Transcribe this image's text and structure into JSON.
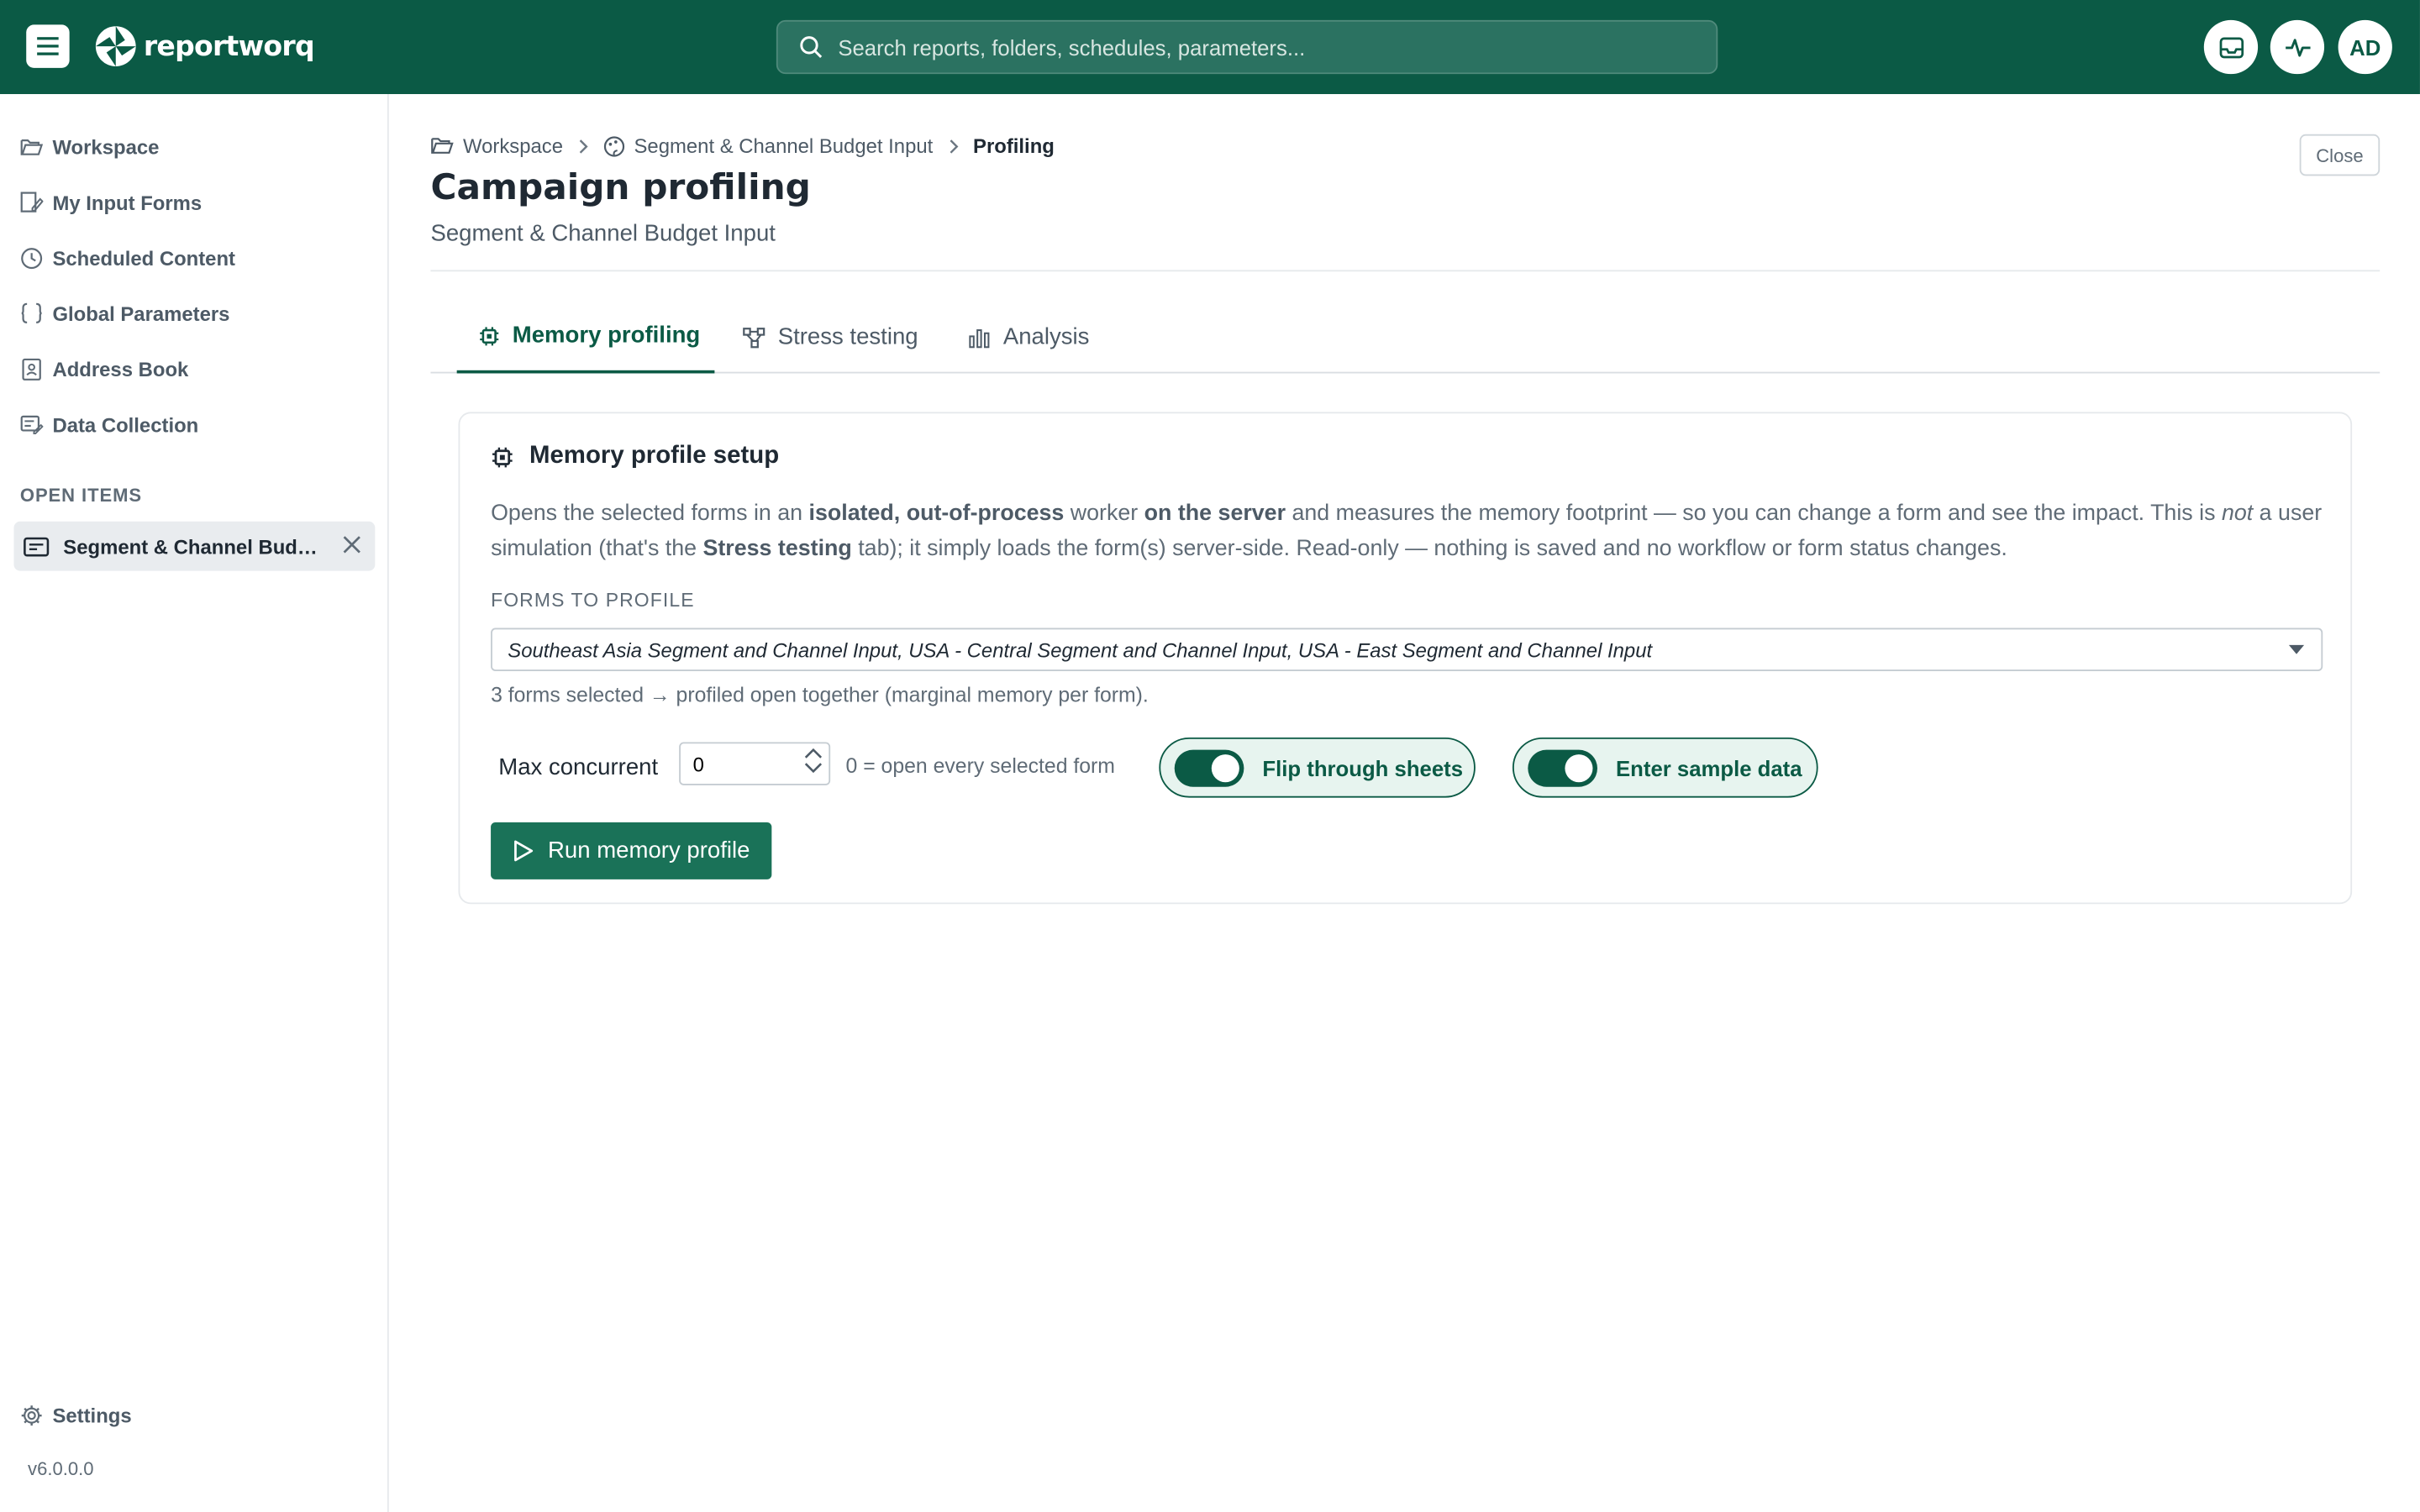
{
  "header": {
    "brand": "reportworq",
    "search_placeholder": "Search reports, folders, schedules, parameters...",
    "avatar_initials": "AD"
  },
  "sidebar": {
    "items": [
      {
        "label": "Workspace",
        "icon": "folder-open-icon"
      },
      {
        "label": "My Input Forms",
        "icon": "form-edit-icon"
      },
      {
        "label": "Scheduled Content",
        "icon": "clock-icon"
      },
      {
        "label": "Global Parameters",
        "icon": "braces-icon"
      },
      {
        "label": "Address Book",
        "icon": "address-book-icon"
      },
      {
        "label": "Data Collection",
        "icon": "data-collection-icon"
      }
    ],
    "open_items_label": "OPEN ITEMS",
    "open_item": "Segment & Channel Budget Input",
    "settings_label": "Settings",
    "version": "v6.0.0.0"
  },
  "breadcrumb": {
    "items": [
      "Workspace",
      "Segment & Channel Budget Input",
      "Profiling"
    ]
  },
  "page": {
    "title": "Campaign profiling",
    "subtitle": "Segment & Channel Budget Input",
    "close_label": "Close"
  },
  "tabs": [
    {
      "label": "Memory profiling",
      "active": true
    },
    {
      "label": "Stress testing",
      "active": false
    },
    {
      "label": "Analysis",
      "active": false
    }
  ],
  "card": {
    "title": "Memory profile setup",
    "description": {
      "p1": "Opens the selected forms in an ",
      "b1": "isolated, out-of-process",
      "p2": " worker ",
      "b2": "on the server",
      "p3": " and measures the memory footprint — so you can change a form and see the impact. This is ",
      "i1": "not",
      "p4": " a user simulation (that's the ",
      "b3": "Stress testing",
      "p5": " tab); it simply loads the form(s) server-side. Read-only — nothing is saved and no workflow or form status changes."
    },
    "forms_label": "FORMS TO PROFILE",
    "forms_selected": "Southeast Asia Segment and Channel Input, USA - Central Segment and Channel Input, USA - East Segment and Channel Input",
    "forms_hint": "3 forms selected → profiled open together (marginal memory per form).",
    "max_concurrent_label": "Max concurrent",
    "max_concurrent_value": "0",
    "max_concurrent_hint": "0 = open every selected form",
    "toggle_flip_label": "Flip through sheets",
    "toggle_flip_on": true,
    "toggle_sample_label": "Enter sample data",
    "toggle_sample_on": true,
    "run_label": "Run memory profile"
  },
  "colors": {
    "brand": "#0b5a45",
    "button": "#1a7258",
    "toggle_bg": "#e7f4ef"
  }
}
